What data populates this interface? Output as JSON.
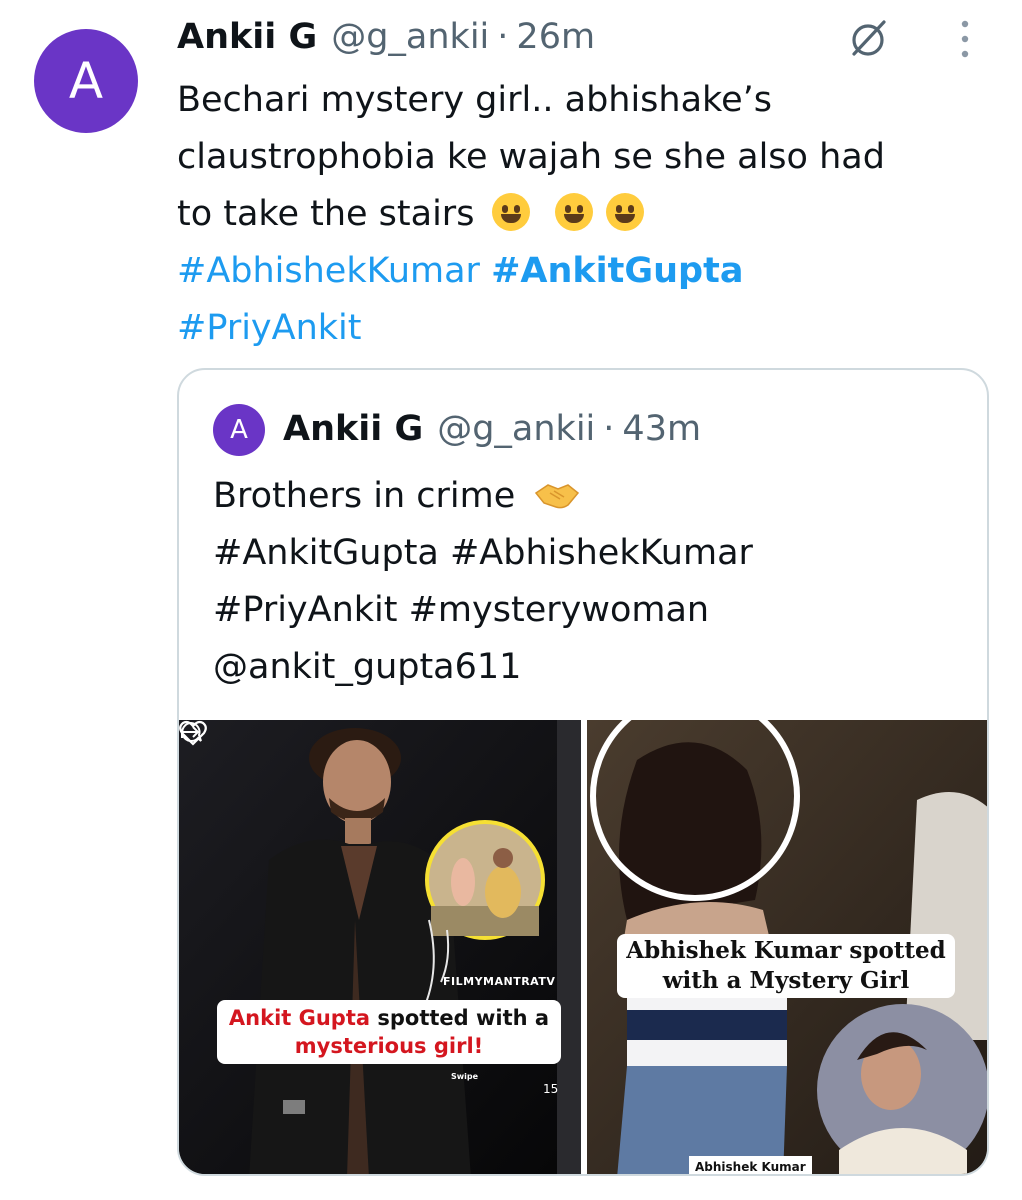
{
  "tweet": {
    "avatar_letter": "A",
    "author_name": "Ankii G",
    "handle": "@g_ankii",
    "separator": "·",
    "time": "26m",
    "text_line1": "Bechari mystery girl.. abhishake’s",
    "text_line2": "claustrophobia ke wajah se she also had",
    "text_line3": "to take the stairs",
    "hashtags": [
      "#AbhishekKumar",
      "#AnkitGupta",
      "#PriyAnkit"
    ],
    "emojis": [
      "smiling-face-with-tear",
      "face-with-tears-of-joy",
      "grinning-face-with-sweat"
    ]
  },
  "quoted_tweet": {
    "avatar_letter": "A",
    "author_name": "Ankii G",
    "handle": "@g_ankii",
    "separator": "·",
    "time": "43m",
    "text_line1": "Brothers in crime",
    "text_line2": "#AnkitGupta #AbhishekKumar",
    "text_line3": "#PriyAnkit #mysterywoman",
    "text_line4": "@ankit_gupta611",
    "emoji": "handshake",
    "media": [
      {
        "watermark": "FILMYMANTRATV",
        "caption_red_1": "Ankit Gupta",
        "caption_black": " spotted with a",
        "caption_red_2": "mysterious girl!",
        "swipe_label": "Swipe",
        "like_count": "15"
      },
      {
        "caption_line1": "Abhishek Kumar spotted",
        "caption_line2": "with a Mystery Girl",
        "name_tag": "Abhishek Kumar"
      }
    ]
  },
  "colors": {
    "accent": "#1d9bf0",
    "avatar": "#6a35c6",
    "secondary_text": "#536471",
    "caption_red": "#d4161f"
  },
  "icons": [
    "grok-icon",
    "more-options-icon",
    "heart-icon",
    "comment-icon",
    "share-icon"
  ]
}
